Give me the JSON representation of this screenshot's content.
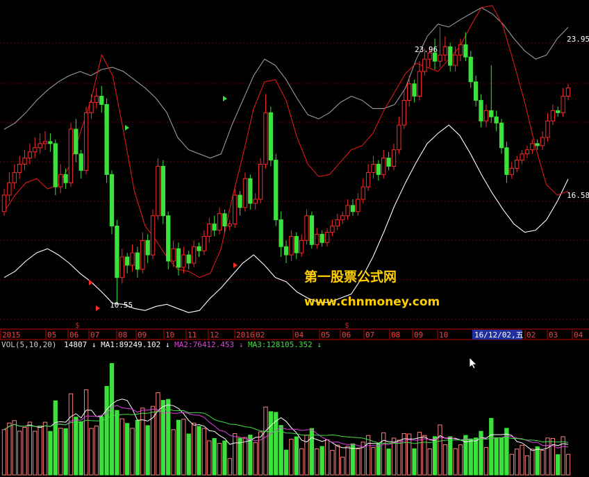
{
  "colors": {
    "background": "#000000",
    "grid": "#7a0000",
    "axis": "#c00000",
    "up": "#ff2a2a",
    "down": "#3be23b",
    "upper_band": "#9a9a9a",
    "lower_band": "#ffffff",
    "indicator": "#e01818",
    "ma1": "#ffffff",
    "ma2": "#e040e0",
    "ma3": "#40e040",
    "label": "#ffffff",
    "watermark": "#ffd000",
    "date_box_bg": "#2030a0",
    "date_box_text": "#ffffff"
  },
  "price_panel": {
    "labels": {
      "upper_peak": "23.96",
      "upper_end": "23.95",
      "lower_end": "16.58",
      "low_point": "10.55"
    }
  },
  "watermark": {
    "line1": "第一股票公式网",
    "line2": "www.chnmoney.com"
  },
  "time_axis": {
    "ticks": [
      "2015",
      "05",
      "06",
      "07",
      "08",
      "09",
      "10",
      "11",
      "12",
      "2016",
      "02",
      "04",
      "05",
      "06",
      "07",
      "08",
      "09",
      "10",
      "02",
      "03",
      "04"
    ],
    "selected_date": "16/12/02,五",
    "markers": [
      "$",
      "$"
    ]
  },
  "volume_header": {
    "name": "VOL(5,10,20)",
    "value": "14807",
    "ma1_label": "MA1:89249.102",
    "ma2_label": "MA2:76412.453",
    "ma3_label": "MA3:128105.352",
    "arrow": "↓"
  },
  "chart_data": {
    "type": "candlestick",
    "price_axis_range": [
      9.5,
      25.0
    ],
    "candles": [
      {
        "o": 15.0,
        "c": 15.8,
        "h": 16.1,
        "l": 14.8
      },
      {
        "o": 15.8,
        "c": 16.4,
        "h": 16.9,
        "l": 15.5
      },
      {
        "o": 16.4,
        "c": 16.9,
        "h": 17.3,
        "l": 16.1
      },
      {
        "o": 16.9,
        "c": 17.3,
        "h": 17.7,
        "l": 16.6
      },
      {
        "o": 17.3,
        "c": 17.6,
        "h": 18.0,
        "l": 17.0
      },
      {
        "o": 17.6,
        "c": 17.9,
        "h": 18.3,
        "l": 17.3
      },
      {
        "o": 17.9,
        "c": 18.1,
        "h": 18.6,
        "l": 17.6
      },
      {
        "o": 18.1,
        "c": 18.3,
        "h": 18.8,
        "l": 17.8
      },
      {
        "o": 18.3,
        "c": 18.4,
        "h": 18.9,
        "l": 18.0
      },
      {
        "o": 18.4,
        "c": 18.3,
        "h": 18.8,
        "l": 17.9
      },
      {
        "o": 18.3,
        "c": 16.2,
        "h": 18.5,
        "l": 15.8
      },
      {
        "o": 16.2,
        "c": 16.8,
        "h": 17.3,
        "l": 15.9
      },
      {
        "o": 16.8,
        "c": 16.4,
        "h": 17.1,
        "l": 16.1
      },
      {
        "o": 16.4,
        "c": 19.0,
        "h": 19.3,
        "l": 16.2
      },
      {
        "o": 19.0,
        "c": 17.8,
        "h": 19.5,
        "l": 17.4
      },
      {
        "o": 17.8,
        "c": 17.0,
        "h": 18.0,
        "l": 16.6
      },
      {
        "o": 17.0,
        "c": 19.8,
        "h": 20.1,
        "l": 16.8
      },
      {
        "o": 19.8,
        "c": 20.3,
        "h": 20.7,
        "l": 19.5
      },
      {
        "o": 20.3,
        "c": 20.6,
        "h": 21.0,
        "l": 20.0
      },
      {
        "o": 20.6,
        "c": 20.2,
        "h": 21.1,
        "l": 19.8
      },
      {
        "o": 20.2,
        "c": 16.8,
        "h": 20.5,
        "l": 16.4
      },
      {
        "o": 16.8,
        "c": 14.3,
        "h": 17.0,
        "l": 13.9
      },
      {
        "o": 14.3,
        "c": 11.8,
        "h": 14.6,
        "l": 10.55
      },
      {
        "o": 11.8,
        "c": 12.8,
        "h": 13.2,
        "l": 11.5
      },
      {
        "o": 12.8,
        "c": 12.4,
        "h": 13.0,
        "l": 12.0
      },
      {
        "o": 12.4,
        "c": 13.0,
        "h": 13.4,
        "l": 12.1
      },
      {
        "o": 13.0,
        "c": 12.2,
        "h": 13.3,
        "l": 11.8
      },
      {
        "o": 12.2,
        "c": 13.6,
        "h": 14.0,
        "l": 12.0
      },
      {
        "o": 13.6,
        "c": 12.9,
        "h": 13.9,
        "l": 12.5
      },
      {
        "o": 12.9,
        "c": 14.8,
        "h": 15.1,
        "l": 12.7
      },
      {
        "o": 14.8,
        "c": 17.2,
        "h": 17.6,
        "l": 14.6
      },
      {
        "o": 17.2,
        "c": 14.8,
        "h": 17.5,
        "l": 14.4
      },
      {
        "o": 14.8,
        "c": 12.6,
        "h": 15.0,
        "l": 12.2
      },
      {
        "o": 12.6,
        "c": 13.2,
        "h": 13.6,
        "l": 12.3
      },
      {
        "o": 13.2,
        "c": 12.3,
        "h": 13.5,
        "l": 11.9
      },
      {
        "o": 12.3,
        "c": 12.9,
        "h": 13.3,
        "l": 12.0
      },
      {
        "o": 12.9,
        "c": 12.5,
        "h": 13.1,
        "l": 12.2
      },
      {
        "o": 12.5,
        "c": 13.3,
        "h": 13.6,
        "l": 12.3
      },
      {
        "o": 13.3,
        "c": 13.1,
        "h": 13.5,
        "l": 12.8
      },
      {
        "o": 13.1,
        "c": 13.8,
        "h": 14.1,
        "l": 12.9
      },
      {
        "o": 13.8,
        "c": 14.4,
        "h": 14.7,
        "l": 13.5
      },
      {
        "o": 14.4,
        "c": 14.1,
        "h": 14.8,
        "l": 13.8
      },
      {
        "o": 14.1,
        "c": 14.9,
        "h": 15.2,
        "l": 13.9
      },
      {
        "o": 14.9,
        "c": 14.3,
        "h": 15.1,
        "l": 14.0
      },
      {
        "o": 14.3,
        "c": 14.4,
        "h": 14.6,
        "l": 14.1
      },
      {
        "o": 14.4,
        "c": 15.8,
        "h": 16.1,
        "l": 14.2
      },
      {
        "o": 15.8,
        "c": 15.2,
        "h": 16.0,
        "l": 14.8
      },
      {
        "o": 15.2,
        "c": 16.6,
        "h": 16.9,
        "l": 15.0
      },
      {
        "o": 16.6,
        "c": 15.4,
        "h": 16.8,
        "l": 15.1
      },
      {
        "o": 15.4,
        "c": 15.6,
        "h": 15.9,
        "l": 15.1
      },
      {
        "o": 15.6,
        "c": 17.3,
        "h": 17.6,
        "l": 15.4
      },
      {
        "o": 17.3,
        "c": 19.8,
        "h": 20.7,
        "l": 17.1
      },
      {
        "o": 19.8,
        "c": 17.5,
        "h": 20.1,
        "l": 17.2
      },
      {
        "o": 17.5,
        "c": 14.6,
        "h": 17.8,
        "l": 14.3
      },
      {
        "o": 14.6,
        "c": 13.3,
        "h": 15.0,
        "l": 12.8
      },
      {
        "o": 13.3,
        "c": 12.9,
        "h": 13.6,
        "l": 12.5
      },
      {
        "o": 12.9,
        "c": 13.8,
        "h": 14.1,
        "l": 12.6
      },
      {
        "o": 13.8,
        "c": 13.0,
        "h": 14.0,
        "l": 12.7
      },
      {
        "o": 13.0,
        "c": 13.6,
        "h": 13.9,
        "l": 12.8
      },
      {
        "o": 13.6,
        "c": 14.8,
        "h": 15.1,
        "l": 13.4
      },
      {
        "o": 14.8,
        "c": 13.4,
        "h": 15.0,
        "l": 13.2
      },
      {
        "o": 13.4,
        "c": 13.9,
        "h": 14.2,
        "l": 13.2
      },
      {
        "o": 13.9,
        "c": 13.5,
        "h": 14.1,
        "l": 13.3
      },
      {
        "o": 13.5,
        "c": 14.0,
        "h": 14.2,
        "l": 13.3
      },
      {
        "o": 14.0,
        "c": 14.3,
        "h": 14.6,
        "l": 13.8
      },
      {
        "o": 14.3,
        "c": 14.6,
        "h": 14.9,
        "l": 14.1
      },
      {
        "o": 14.6,
        "c": 14.8,
        "h": 15.0,
        "l": 14.4
      },
      {
        "o": 14.8,
        "c": 15.3,
        "h": 15.6,
        "l": 14.6
      },
      {
        "o": 15.3,
        "c": 15.0,
        "h": 15.6,
        "l": 14.8
      },
      {
        "o": 15.0,
        "c": 15.6,
        "h": 15.9,
        "l": 14.8
      },
      {
        "o": 15.6,
        "c": 16.2,
        "h": 16.6,
        "l": 15.4
      },
      {
        "o": 16.2,
        "c": 16.9,
        "h": 17.3,
        "l": 16.0
      },
      {
        "o": 16.9,
        "c": 17.3,
        "h": 17.7,
        "l": 16.6
      },
      {
        "o": 17.3,
        "c": 16.8,
        "h": 17.5,
        "l": 16.5
      },
      {
        "o": 16.8,
        "c": 17.6,
        "h": 18.0,
        "l": 16.6
      },
      {
        "o": 17.6,
        "c": 17.2,
        "h": 17.9,
        "l": 17.0
      },
      {
        "o": 17.2,
        "c": 18.0,
        "h": 18.3,
        "l": 17.0
      },
      {
        "o": 18.0,
        "c": 19.2,
        "h": 19.6,
        "l": 17.8
      },
      {
        "o": 19.2,
        "c": 20.4,
        "h": 20.9,
        "l": 19.0
      },
      {
        "o": 20.4,
        "c": 21.2,
        "h": 21.6,
        "l": 20.1
      },
      {
        "o": 21.2,
        "c": 20.6,
        "h": 21.4,
        "l": 20.3
      },
      {
        "o": 20.6,
        "c": 21.8,
        "h": 22.3,
        "l": 20.4
      },
      {
        "o": 21.8,
        "c": 22.4,
        "h": 22.9,
        "l": 21.6
      },
      {
        "o": 22.4,
        "c": 22.7,
        "h": 23.0,
        "l": 22.0
      },
      {
        "o": 22.7,
        "c": 22.3,
        "h": 23.4,
        "l": 21.9
      },
      {
        "o": 22.3,
        "c": 22.6,
        "h": 23.96,
        "l": 22.0
      },
      {
        "o": 22.6,
        "c": 23.0,
        "h": 23.5,
        "l": 22.3
      },
      {
        "o": 23.0,
        "c": 22.1,
        "h": 23.2,
        "l": 21.8
      },
      {
        "o": 22.1,
        "c": 22.6,
        "h": 23.0,
        "l": 21.8
      },
      {
        "o": 22.6,
        "c": 23.1,
        "h": 23.4,
        "l": 22.3
      },
      {
        "o": 23.1,
        "c": 22.5,
        "h": 23.7,
        "l": 22.3
      },
      {
        "o": 22.5,
        "c": 21.3,
        "h": 22.8,
        "l": 21.0
      },
      {
        "o": 21.3,
        "c": 20.4,
        "h": 21.6,
        "l": 20.1
      },
      {
        "o": 20.4,
        "c": 19.4,
        "h": 20.7,
        "l": 19.1
      },
      {
        "o": 19.4,
        "c": 19.9,
        "h": 20.2,
        "l": 19.1
      },
      {
        "o": 19.9,
        "c": 19.6,
        "h": 22.1,
        "l": 19.3
      },
      {
        "o": 19.6,
        "c": 19.3,
        "h": 19.9,
        "l": 18.9
      },
      {
        "o": 19.3,
        "c": 18.1,
        "h": 19.5,
        "l": 17.8
      },
      {
        "o": 18.1,
        "c": 16.8,
        "h": 18.4,
        "l": 16.4
      },
      {
        "o": 16.8,
        "c": 17.1,
        "h": 17.4,
        "l": 16.6
      },
      {
        "o": 17.1,
        "c": 17.5,
        "h": 17.7,
        "l": 16.9
      },
      {
        "o": 17.5,
        "c": 17.8,
        "h": 18.0,
        "l": 17.3
      },
      {
        "o": 17.8,
        "c": 18.0,
        "h": 18.2,
        "l": 17.6
      },
      {
        "o": 18.0,
        "c": 18.3,
        "h": 18.5,
        "l": 17.8
      },
      {
        "o": 18.3,
        "c": 18.2,
        "h": 18.5,
        "l": 18.0
      },
      {
        "o": 18.2,
        "c": 18.6,
        "h": 18.9,
        "l": 18.0
      },
      {
        "o": 18.6,
        "c": 19.4,
        "h": 19.8,
        "l": 18.4
      },
      {
        "o": 19.4,
        "c": 19.9,
        "h": 20.2,
        "l": 19.2
      },
      {
        "o": 19.9,
        "c": 19.8,
        "h": 20.1,
        "l": 19.6
      },
      {
        "o": 19.8,
        "c": 20.6,
        "h": 21.0,
        "l": 19.6
      },
      {
        "o": 20.6,
        "c": 21.0,
        "h": 21.2,
        "l": 20.4
      }
    ],
    "upper_band": [
      19.0,
      19.3,
      19.8,
      20.4,
      20.9,
      21.3,
      21.6,
      21.8,
      21.6,
      21.9,
      22.0,
      21.8,
      21.4,
      21.0,
      20.5,
      19.8,
      18.6,
      18.0,
      17.8,
      17.6,
      17.8,
      19.2,
      20.4,
      21.6,
      22.4,
      22.1,
      21.4,
      20.5,
      19.7,
      19.5,
      19.8,
      20.3,
      20.6,
      20.4,
      20.0,
      20.0,
      20.2,
      21.0,
      22.4,
      23.5,
      24.1,
      23.96,
      24.3,
      24.6,
      24.9,
      24.6,
      24.1,
      23.4,
      22.8,
      22.4,
      22.6,
      23.4,
      23.95
    ],
    "lower_band": [
      11.8,
      12.1,
      12.6,
      13.0,
      13.2,
      12.9,
      12.5,
      12.0,
      11.6,
      11.1,
      10.55,
      10.5,
      10.3,
      10.2,
      10.4,
      10.5,
      10.3,
      10.1,
      10.2,
      10.8,
      11.3,
      11.9,
      12.5,
      12.9,
      12.4,
      11.8,
      11.6,
      11.1,
      10.8,
      10.6,
      10.6,
      10.8,
      11.0,
      11.8,
      12.8,
      14.0,
      15.3,
      16.4,
      17.4,
      18.3,
      18.8,
      19.2,
      18.7,
      17.8,
      16.8,
      15.9,
      15.1,
      14.4,
      14.0,
      14.1,
      14.6,
      15.5,
      16.58
    ],
    "indicator_line": [
      15.0,
      15.8,
      16.4,
      16.6,
      16.1,
      16.3,
      17.2,
      18.8,
      20.4,
      22.6,
      21.6,
      18.9,
      16.0,
      14.3,
      13.6,
      12.8,
      12.2,
      12.1,
      11.8,
      12.0,
      13.2,
      15.6,
      17.7,
      20.0,
      21.3,
      21.4,
      20.4,
      18.6,
      17.3,
      16.7,
      16.8,
      17.4,
      18.0,
      18.2,
      18.8,
      19.9,
      20.8,
      21.7,
      22.2,
      22.0,
      21.8,
      22.4,
      23.0,
      24.0,
      24.9,
      25.0,
      24.0,
      22.2,
      20.3,
      18.1,
      16.3,
      15.8,
      16.0
    ]
  }
}
